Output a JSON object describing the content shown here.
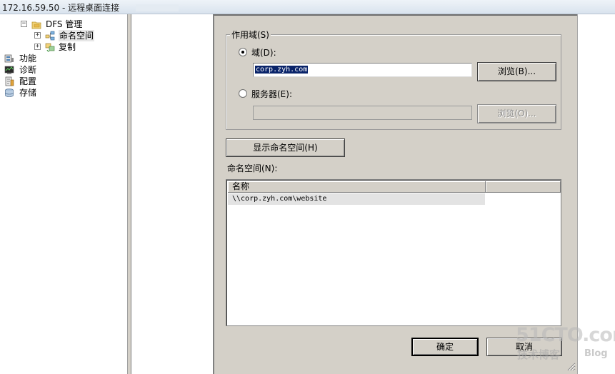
{
  "window": {
    "title": "172.16.59.50 - 远程桌面连接"
  },
  "tree": {
    "root": {
      "label": "DFS 管理",
      "expander": "−"
    },
    "children": [
      {
        "label": "命名空间",
        "expander": "+"
      },
      {
        "label": "复制",
        "expander": "+"
      }
    ],
    "items": [
      {
        "label": "功能"
      },
      {
        "label": "诊断"
      },
      {
        "label": "配置"
      },
      {
        "label": "存储"
      }
    ]
  },
  "dialog": {
    "scope_group": {
      "title": "作用域(S)",
      "domain_radio": {
        "label": "域(D):",
        "checked": true
      },
      "domain_value": "corp.zyh.com",
      "browse_domain_label": "浏览(B)...",
      "server_radio": {
        "label": "服务器(E):",
        "checked": false
      },
      "server_value": "",
      "browse_server_label": "浏览(O)..."
    },
    "show_namespaces_label": "显示命名空间(H)",
    "namespaces_label": "命名空间(N):",
    "namespaces_list": {
      "columns": [
        "名称",
        ""
      ],
      "rows": [
        "\\\\corp.zyh.com\\website"
      ]
    },
    "ok_label": "确定",
    "cancel_label": "取消"
  },
  "watermark": {
    "main": "51CTO.com",
    "sub": "技术博客",
    "tag": "Blog"
  }
}
